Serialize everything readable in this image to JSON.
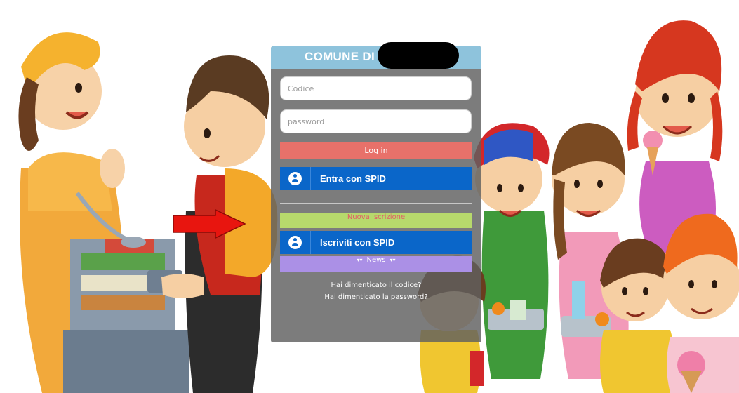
{
  "panel": {
    "title": "COMUNE DI",
    "code_placeholder": "Codice",
    "password_placeholder": "password",
    "login_label": "Log in",
    "spid_login_label": "Entra con SPID",
    "new_registration_label": "Nuova Iscrizione",
    "spid_register_label": "Iscriviti con SPID",
    "news_label": "News",
    "forgot_code_link": "Hai dimenticato il codice?",
    "forgot_password_link": "Hai dimenticato la password?"
  },
  "icons": {
    "spid": "user-circle-icon",
    "news_chevrons": "double-chevron-down-icon",
    "pointer": "red-arrow-icon"
  },
  "colors": {
    "header": "#8ec3dc",
    "login_button": "#e8716a",
    "spid_button": "#0a66c9",
    "new_registration": "#b7d96c",
    "news_button": "#ab90e6",
    "arrow": "#e8150f"
  }
}
